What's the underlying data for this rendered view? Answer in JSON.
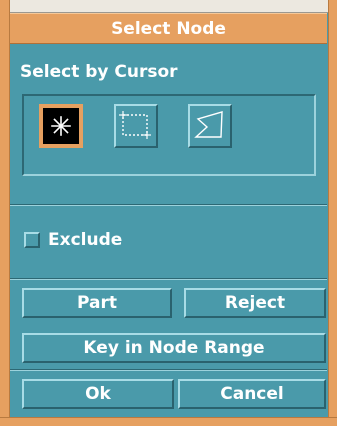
{
  "dialog": {
    "title": "Select Node"
  },
  "select_by_cursor": {
    "label": "Select by Cursor",
    "tools": [
      {
        "name": "single-point-select",
        "icon": "asterisk-icon",
        "selected": true
      },
      {
        "name": "box-select",
        "icon": "dashed-rectangle-icon",
        "selected": false
      },
      {
        "name": "polygon-select",
        "icon": "polygon-icon",
        "selected": false
      }
    ]
  },
  "exclude": {
    "label": "Exclude",
    "checked": false
  },
  "buttons": {
    "part": "Part",
    "reject": "Reject",
    "key_in_node_range": "Key in Node Range",
    "ok": "Ok",
    "cancel": "Cancel"
  },
  "colors": {
    "panel": "#4a9aaa",
    "title_bar": "#e6a060",
    "text": "#ffffff",
    "selected_tool_bg": "#000000"
  }
}
